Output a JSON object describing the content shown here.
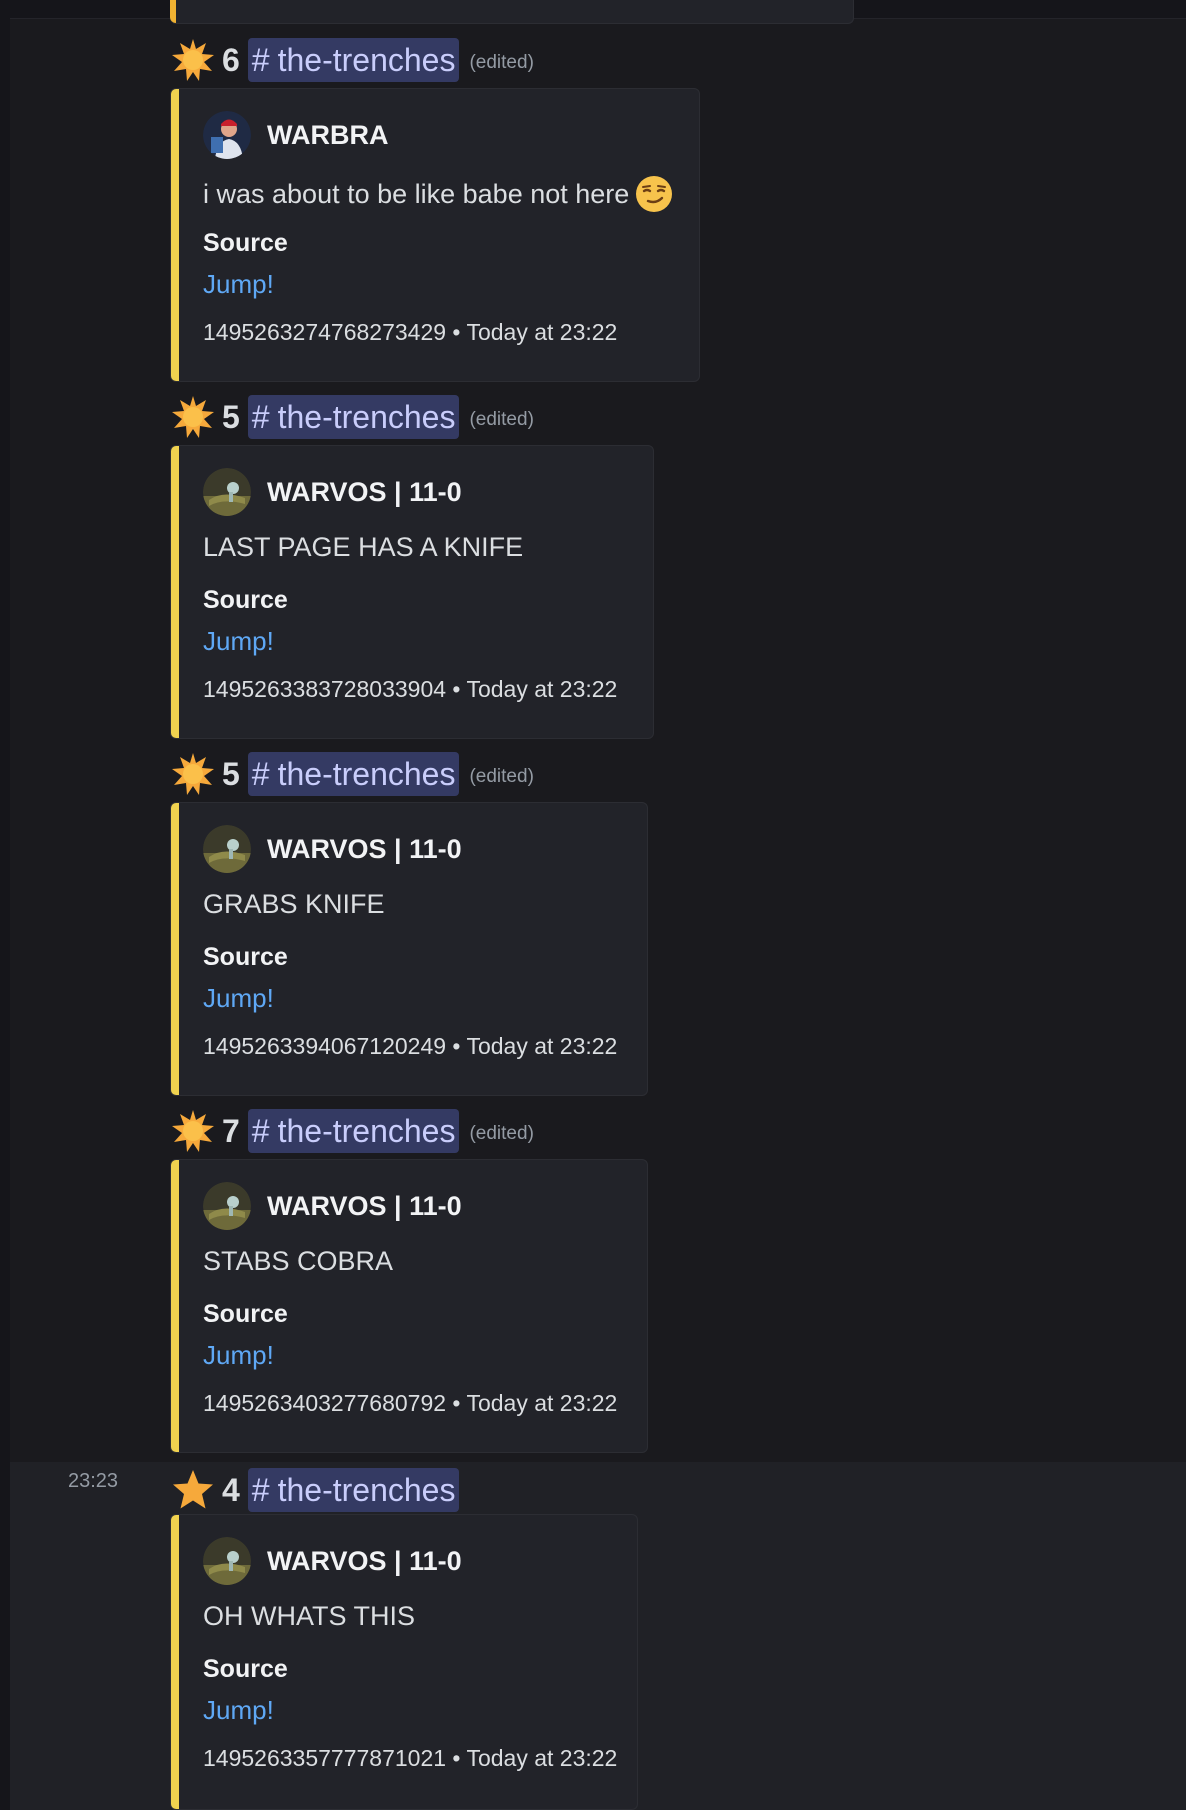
{
  "colors": {
    "background": "#1a1a1e",
    "embed_bg": "#222329",
    "embed_accent": "#f0d24f",
    "link": "#5fa8f5",
    "mention_bg": "#343a63",
    "mention_text": "#c9cdfb",
    "star": "#f6a93b"
  },
  "messages": [
    {
      "star_icon": "glowing-star-icon",
      "count": "6",
      "channel": "the-trenches",
      "edited": "(edited)",
      "embed": {
        "author": "WARBRA",
        "description": "i was about to be like babe not here",
        "description_emoji": "smirking-face-emoji",
        "field_name": "Source",
        "field_value": "Jump!",
        "footer": "1495263274768273429 • Today at 23:22"
      }
    },
    {
      "star_icon": "glowing-star-icon",
      "count": "5",
      "channel": "the-trenches",
      "edited": "(edited)",
      "embed": {
        "author": "WARVOS | 11-0",
        "description": "LAST PAGE HAS A KNIFE",
        "field_name": "Source",
        "field_value": "Jump!",
        "footer": "1495263383728033904 • Today at 23:22"
      }
    },
    {
      "star_icon": "glowing-star-icon",
      "count": "5",
      "channel": "the-trenches",
      "edited": "(edited)",
      "embed": {
        "author": "WARVOS | 11-0",
        "description": "GRABS KNIFE",
        "field_name": "Source",
        "field_value": "Jump!",
        "footer": "1495263394067120249 • Today at 23:22"
      }
    },
    {
      "star_icon": "glowing-star-icon",
      "count": "7",
      "channel": "the-trenches",
      "edited": "(edited)",
      "embed": {
        "author": "WARVOS | 11-0",
        "description": "STABS COBRA",
        "field_name": "Source",
        "field_value": "Jump!",
        "footer": "1495263403277680792 • Today at 23:22"
      }
    },
    {
      "timestamp": "23:23",
      "star_icon": "star-icon",
      "count": "4",
      "channel": "the-trenches",
      "embed": {
        "author": "WARVOS | 11-0",
        "description": "OH WHATS THIS",
        "field_name": "Source",
        "field_value": "Jump!",
        "footer": "1495263357777871021 • Today at 23:22"
      }
    }
  ]
}
